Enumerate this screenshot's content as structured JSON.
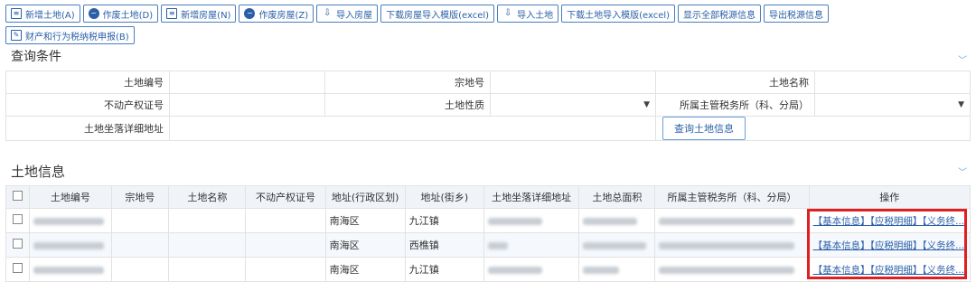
{
  "toolbar": {
    "row1": [
      {
        "label": "新增土地(A)",
        "icon": "add-doc-icon"
      },
      {
        "label": "作废土地(D)",
        "icon": "void-icon"
      },
      {
        "label": "新增房屋(N)",
        "icon": "add-doc-icon"
      },
      {
        "label": "作废房屋(Z)",
        "icon": "void-icon"
      },
      {
        "label": "导入房屋",
        "icon": "import-icon"
      },
      {
        "label": "下载房屋导入模版(excel)",
        "icon": ""
      },
      {
        "label": "导入土地",
        "icon": "import-icon"
      },
      {
        "label": "下载土地导入模版(excel)",
        "icon": ""
      },
      {
        "label": "显示全部税源信息",
        "icon": ""
      },
      {
        "label": "导出税源信息",
        "icon": ""
      }
    ],
    "row2": [
      {
        "label": "财产和行为税纳税申报(B)",
        "icon": "edit-icon"
      }
    ]
  },
  "query": {
    "title": "查询条件",
    "labels": {
      "land_no": "土地编号",
      "parcel_no": "宗地号",
      "land_name": "土地名称",
      "property_cert": "不动产权证号",
      "land_nature": "土地性质",
      "tax_office": "所属主管税务所（科、分局）",
      "address": "土地坐落详细地址"
    },
    "button": "查询土地信息"
  },
  "land_info": {
    "title": "土地信息",
    "columns": [
      "土地编号",
      "宗地号",
      "土地名称",
      "不动产权证号",
      "地址(行政区划)",
      "地址(街乡)",
      "土地坐落详细地址",
      "土地总面积",
      "所属主管税务所（科、分局）",
      "操作"
    ],
    "rows": [
      {
        "district": "南海区",
        "town": "九江镇"
      },
      {
        "district": "南海区",
        "town": "西樵镇"
      },
      {
        "district": "南海区",
        "town": "九江镇"
      }
    ],
    "actions": [
      "【基本信息】",
      "【应税明细】",
      "【义务终..."
    ]
  }
}
